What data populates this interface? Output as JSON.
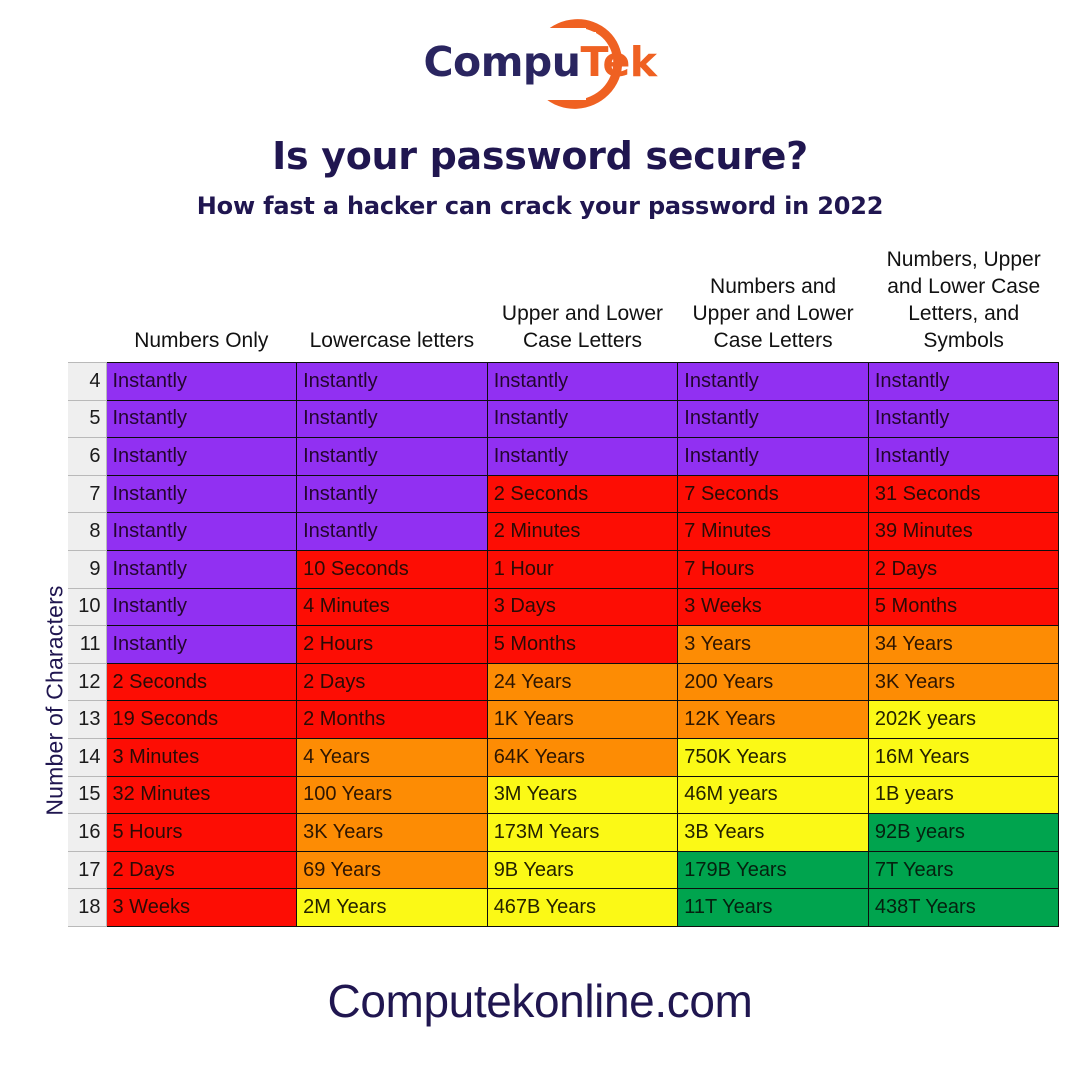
{
  "brand": {
    "logo_text_part1": "Compu",
    "logo_text_part2": "Tek",
    "logo_navy": "#2a2560",
    "logo_orange": "#ef6122"
  },
  "header": {
    "title": "Is your password secure?",
    "subtitle": "How fast a hacker can crack your password in 2022"
  },
  "axis": {
    "y_label": "Number of Characters"
  },
  "footer": {
    "website": "Computekonline.com"
  },
  "legend_colors": {
    "instant_purple": "#9130f2",
    "fast_red": "#fd0d04",
    "medium_orange": "#fd8c04",
    "slow_yellow": "#fbf916",
    "safe_green": "#00a44e"
  },
  "chart_data": {
    "type": "heatmap",
    "title": "Is your password secure?",
    "subtitle": "How fast a hacker can crack your password in 2022",
    "ylabel": "Number of Characters",
    "xlabel": "",
    "grid": true,
    "legend": "none",
    "row_header_label": "",
    "categories": [
      "Numbers Only",
      "Lowercase letters",
      "Upper and Lower Case Letters",
      "Numbers and Upper and Lower Case Letters",
      "Numbers, Upper and Lower Case Letters, and Symbols"
    ],
    "rows": [
      {
        "chars": "4",
        "cells": [
          {
            "text": "Instantly",
            "color": "purple"
          },
          {
            "text": "Instantly",
            "color": "purple"
          },
          {
            "text": "Instantly",
            "color": "purple"
          },
          {
            "text": "Instantly",
            "color": "purple"
          },
          {
            "text": "Instantly",
            "color": "purple"
          }
        ]
      },
      {
        "chars": "5",
        "cells": [
          {
            "text": "Instantly",
            "color": "purple"
          },
          {
            "text": "Instantly",
            "color": "purple"
          },
          {
            "text": "Instantly",
            "color": "purple"
          },
          {
            "text": "Instantly",
            "color": "purple"
          },
          {
            "text": "Instantly",
            "color": "purple"
          }
        ]
      },
      {
        "chars": "6",
        "cells": [
          {
            "text": "Instantly",
            "color": "purple"
          },
          {
            "text": "Instantly",
            "color": "purple"
          },
          {
            "text": "Instantly",
            "color": "purple"
          },
          {
            "text": "Instantly",
            "color": "purple"
          },
          {
            "text": "Instantly",
            "color": "purple"
          }
        ]
      },
      {
        "chars": "7",
        "cells": [
          {
            "text": "Instantly",
            "color": "purple"
          },
          {
            "text": "Instantly",
            "color": "purple"
          },
          {
            "text": "2 Seconds",
            "color": "red"
          },
          {
            "text": "7 Seconds",
            "color": "red"
          },
          {
            "text": "31 Seconds",
            "color": "red"
          }
        ]
      },
      {
        "chars": "8",
        "cells": [
          {
            "text": "Instantly",
            "color": "purple"
          },
          {
            "text": "Instantly",
            "color": "purple"
          },
          {
            "text": "2 Minutes",
            "color": "red"
          },
          {
            "text": "7 Minutes",
            "color": "red"
          },
          {
            "text": "39 Minutes",
            "color": "red"
          }
        ]
      },
      {
        "chars": "9",
        "cells": [
          {
            "text": "Instantly",
            "color": "purple"
          },
          {
            "text": "10 Seconds",
            "color": "red"
          },
          {
            "text": "1 Hour",
            "color": "red"
          },
          {
            "text": "7 Hours",
            "color": "red"
          },
          {
            "text": "2 Days",
            "color": "red"
          }
        ]
      },
      {
        "chars": "10",
        "cells": [
          {
            "text": "Instantly",
            "color": "purple"
          },
          {
            "text": "4 Minutes",
            "color": "red"
          },
          {
            "text": "3 Days",
            "color": "red"
          },
          {
            "text": "3 Weeks",
            "color": "red"
          },
          {
            "text": "5 Months",
            "color": "red"
          }
        ]
      },
      {
        "chars": "11",
        "cells": [
          {
            "text": "Instantly",
            "color": "purple"
          },
          {
            "text": "2 Hours",
            "color": "red"
          },
          {
            "text": "5 Months",
            "color": "red"
          },
          {
            "text": "3 Years",
            "color": "orange"
          },
          {
            "text": "34 Years",
            "color": "orange"
          }
        ]
      },
      {
        "chars": "12",
        "cells": [
          {
            "text": "2 Seconds",
            "color": "red"
          },
          {
            "text": "2 Days",
            "color": "red"
          },
          {
            "text": "24 Years",
            "color": "orange"
          },
          {
            "text": "200 Years",
            "color": "orange"
          },
          {
            "text": "3K Years",
            "color": "orange"
          }
        ]
      },
      {
        "chars": "13",
        "cells": [
          {
            "text": "19 Seconds",
            "color": "red"
          },
          {
            "text": "2 Months",
            "color": "red"
          },
          {
            "text": "1K Years",
            "color": "orange"
          },
          {
            "text": "12K Years",
            "color": "orange"
          },
          {
            "text": "202K years",
            "color": "yellow"
          }
        ]
      },
      {
        "chars": "14",
        "cells": [
          {
            "text": "3 Minutes",
            "color": "red"
          },
          {
            "text": "4 Years",
            "color": "orange"
          },
          {
            "text": "64K Years",
            "color": "orange"
          },
          {
            "text": "750K Years",
            "color": "yellow"
          },
          {
            "text": "16M Years",
            "color": "yellow"
          }
        ]
      },
      {
        "chars": "15",
        "cells": [
          {
            "text": "32 Minutes",
            "color": "red"
          },
          {
            "text": "100 Years",
            "color": "orange"
          },
          {
            "text": "3M Years",
            "color": "yellow"
          },
          {
            "text": "46M years",
            "color": "yellow"
          },
          {
            "text": "1B years",
            "color": "yellow"
          }
        ]
      },
      {
        "chars": "16",
        "cells": [
          {
            "text": "5 Hours",
            "color": "red"
          },
          {
            "text": "3K Years",
            "color": "orange"
          },
          {
            "text": "173M Years",
            "color": "yellow"
          },
          {
            "text": "3B Years",
            "color": "yellow"
          },
          {
            "text": "92B years",
            "color": "green"
          }
        ]
      },
      {
        "chars": "17",
        "cells": [
          {
            "text": "2 Days",
            "color": "red"
          },
          {
            "text": "69 Years",
            "color": "orange"
          },
          {
            "text": "9B Years",
            "color": "yellow"
          },
          {
            "text": "179B Years",
            "color": "green"
          },
          {
            "text": "7T Years",
            "color": "green"
          }
        ]
      },
      {
        "chars": "18",
        "cells": [
          {
            "text": "3 Weeks",
            "color": "red"
          },
          {
            "text": "2M Years",
            "color": "yellow"
          },
          {
            "text": "467B Years",
            "color": "yellow"
          },
          {
            "text": "11T Years",
            "color": "green"
          },
          {
            "text": "438T Years",
            "color": "green"
          }
        ]
      }
    ]
  }
}
